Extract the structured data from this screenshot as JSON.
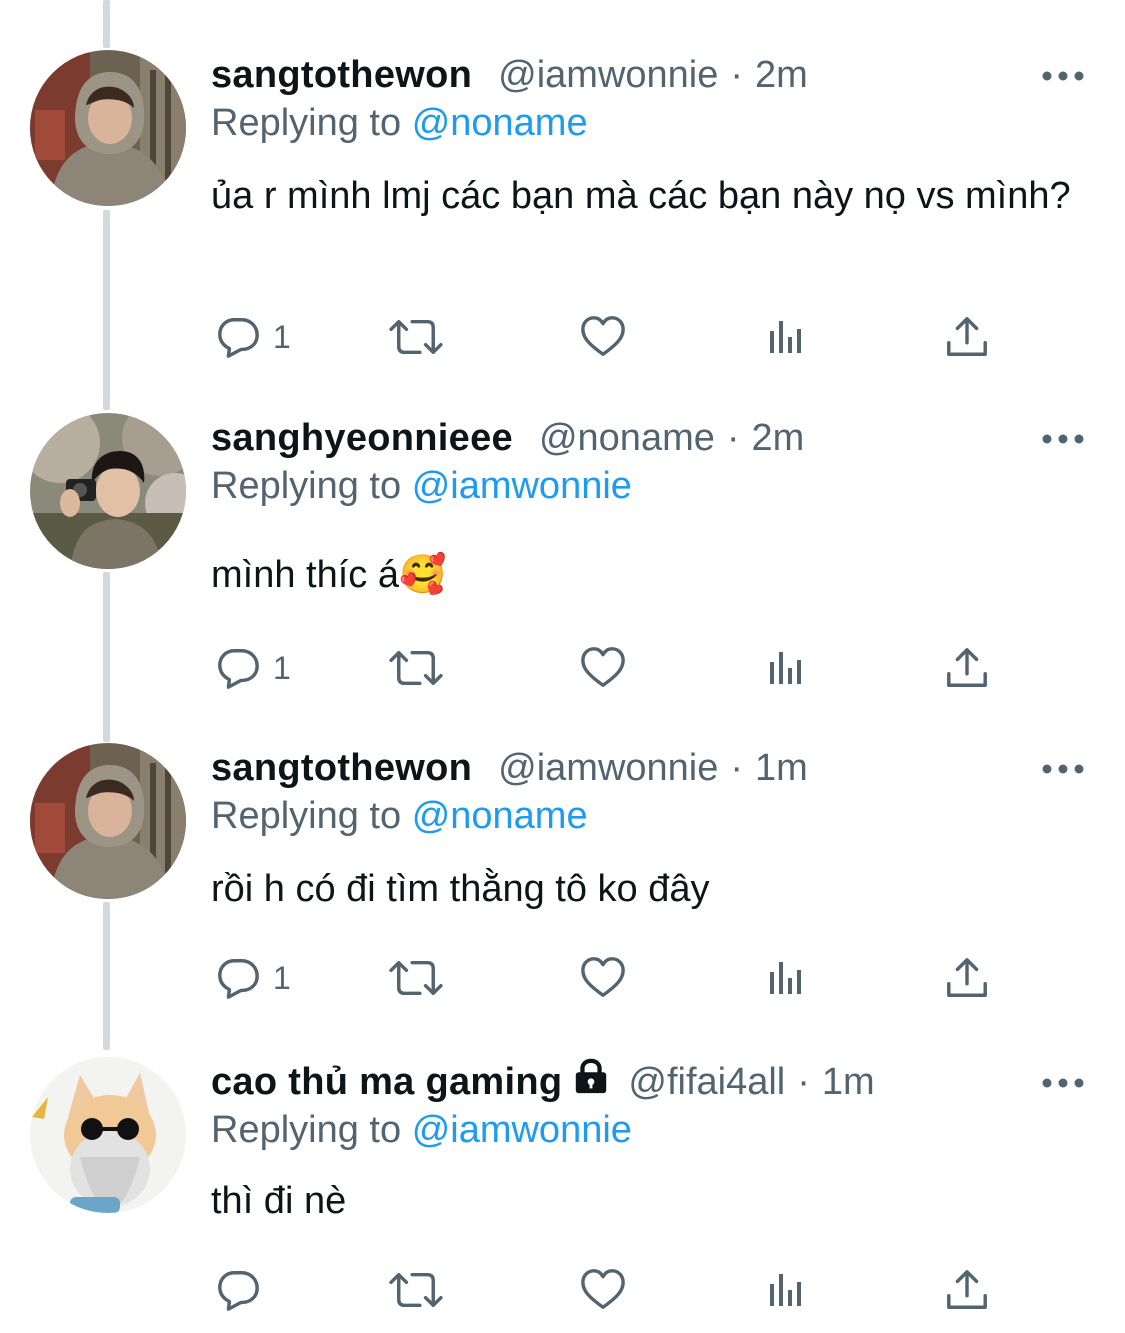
{
  "colors": {
    "text_primary": "#0f1419",
    "text_secondary": "#536471",
    "mention": "#1d9bf0",
    "thread_line": "#cfd9de"
  },
  "tweets": [
    {
      "avatar_icon": "avatar-photo-hooded-boy",
      "name": "sangtothewon",
      "locked": false,
      "handle": "@iamwonnie",
      "separator": "·",
      "time": "2m",
      "replying_label": "Replying to",
      "replying_to": "@noname",
      "text": "ủa r mình lmj các bạn mà các bạn này nọ vs mình?",
      "reply_count": "1"
    },
    {
      "avatar_icon": "avatar-photo-boy-camera",
      "name": "sanghyeonnieee",
      "locked": false,
      "handle": "@noname",
      "separator": "·",
      "time": "2m",
      "replying_label": "Replying to",
      "replying_to": "@iamwonnie",
      "text": "mình thíc á🥰",
      "reply_count": "1"
    },
    {
      "avatar_icon": "avatar-photo-hooded-boy",
      "name": "sangtothewon",
      "locked": false,
      "handle": "@iamwonnie",
      "separator": "·",
      "time": "1m",
      "replying_label": "Replying to",
      "replying_to": "@noname",
      "text": "rồi h có đi tìm thằng tô ko đây",
      "reply_count": "1"
    },
    {
      "avatar_icon": "avatar-cat-sunglasses",
      "name": "cao thủ ma gaming",
      "locked": true,
      "handle": "@fifai4all",
      "separator": "·",
      "time": "1m",
      "replying_label": "Replying to",
      "replying_to": "@iamwonnie",
      "text": "thì đi nè",
      "reply_count": ""
    }
  ],
  "icons": {
    "more": "more-horizontal-icon",
    "reply": "reply-bubble-icon",
    "retweet": "retweet-icon",
    "like": "heart-icon",
    "views": "views-bar-chart-icon",
    "share": "share-upload-icon",
    "lock": "lock-icon"
  }
}
